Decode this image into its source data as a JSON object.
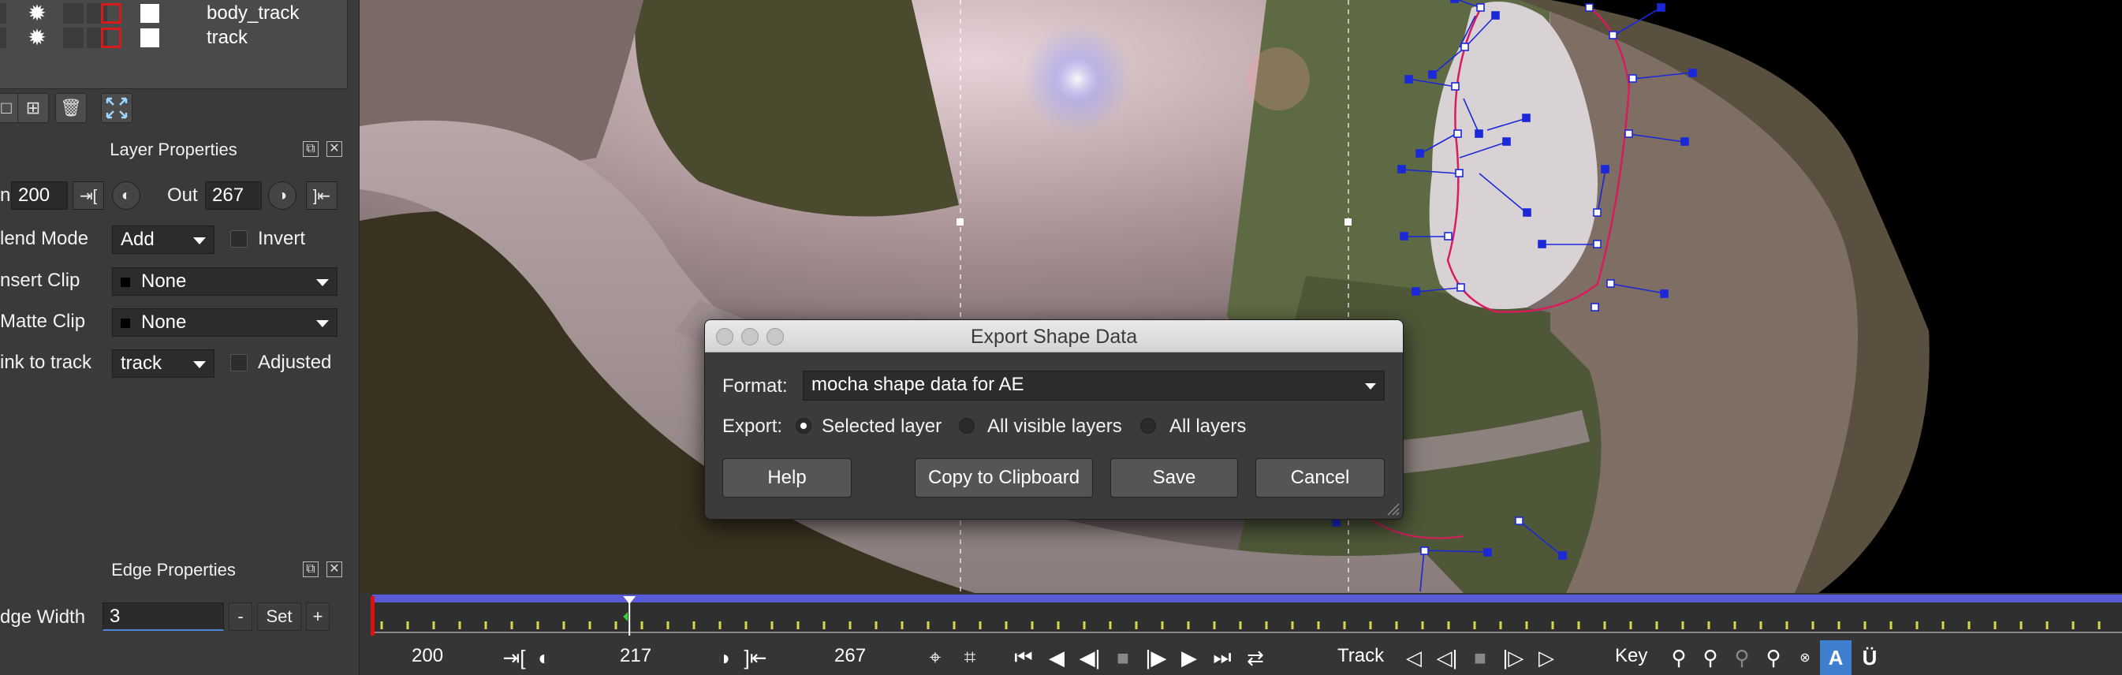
{
  "layers": [
    {
      "name": "body_track",
      "visible_icon": "gear-icon"
    },
    {
      "name": "track",
      "visible_icon": "gear-icon"
    }
  ],
  "layer_toolbar": [
    "new-layer-icon",
    "add-layer-icon",
    "trash-icon",
    "fit-view-icon"
  ],
  "layer_properties": {
    "header": "Layer Properties",
    "in_label": "n",
    "in_value": "200",
    "out_label": "Out",
    "out_value": "267",
    "blend_mode_label": "lend Mode",
    "blend_mode_value": "Add",
    "invert_label": "Invert",
    "insert_clip_label": "nsert Clip",
    "insert_clip_value": "None",
    "matte_clip_label": "Matte Clip",
    "matte_clip_value": "None",
    "link_to_track_label": "ink to track",
    "link_to_track_value": "track",
    "adjusted_label": "Adjusted"
  },
  "edge_properties": {
    "header": "Edge Properties",
    "edge_width_label": "dge Width",
    "edge_width_value": "3",
    "minus": "-",
    "set": "Set",
    "plus": "+"
  },
  "dialog": {
    "title": "Export Shape Data",
    "format_label": "Format:",
    "format_value": "mocha shape data for AE",
    "export_label": "Export:",
    "options": [
      {
        "label": "Selected layer",
        "checked": true
      },
      {
        "label": "All visible layers",
        "checked": false
      },
      {
        "label": "All layers",
        "checked": false
      }
    ],
    "buttons": {
      "help": "Help",
      "copy": "Copy to Clipboard",
      "save": "Save",
      "cancel": "Cancel"
    }
  },
  "timeline": {
    "in_frame": "200",
    "current_frame": "217",
    "out_frame": "267",
    "track_label": "Track",
    "key_label": "Key",
    "playhead_fraction": 0.147,
    "accent_color": "#5a5ad6"
  }
}
